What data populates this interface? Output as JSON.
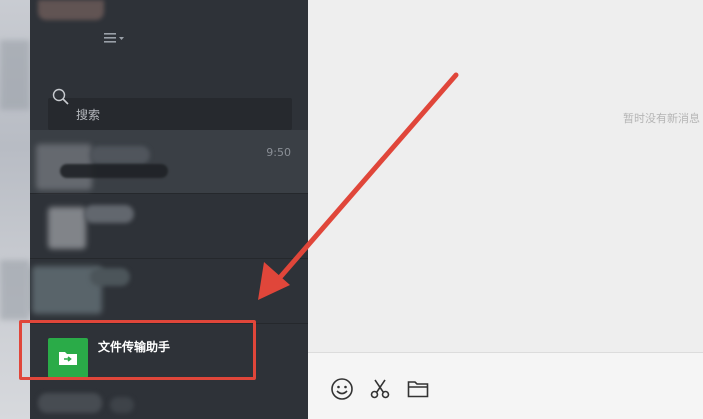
{
  "sidebar": {
    "search_placeholder": "搜索",
    "menu_icon": "menu-icon",
    "chats": [
      {
        "time": "9:50"
      },
      {},
      {},
      {
        "label": "文件传输助手",
        "icon": "folder-arrow-icon"
      }
    ]
  },
  "main": {
    "empty_text": "暂时没有新消息"
  },
  "compose_tools": [
    "emoji-icon",
    "scissors-icon",
    "folder-icon"
  ],
  "colors": {
    "sidebar": "#2e3238",
    "file_helper_green": "#2aab48",
    "annotation_red": "#e0463a"
  }
}
